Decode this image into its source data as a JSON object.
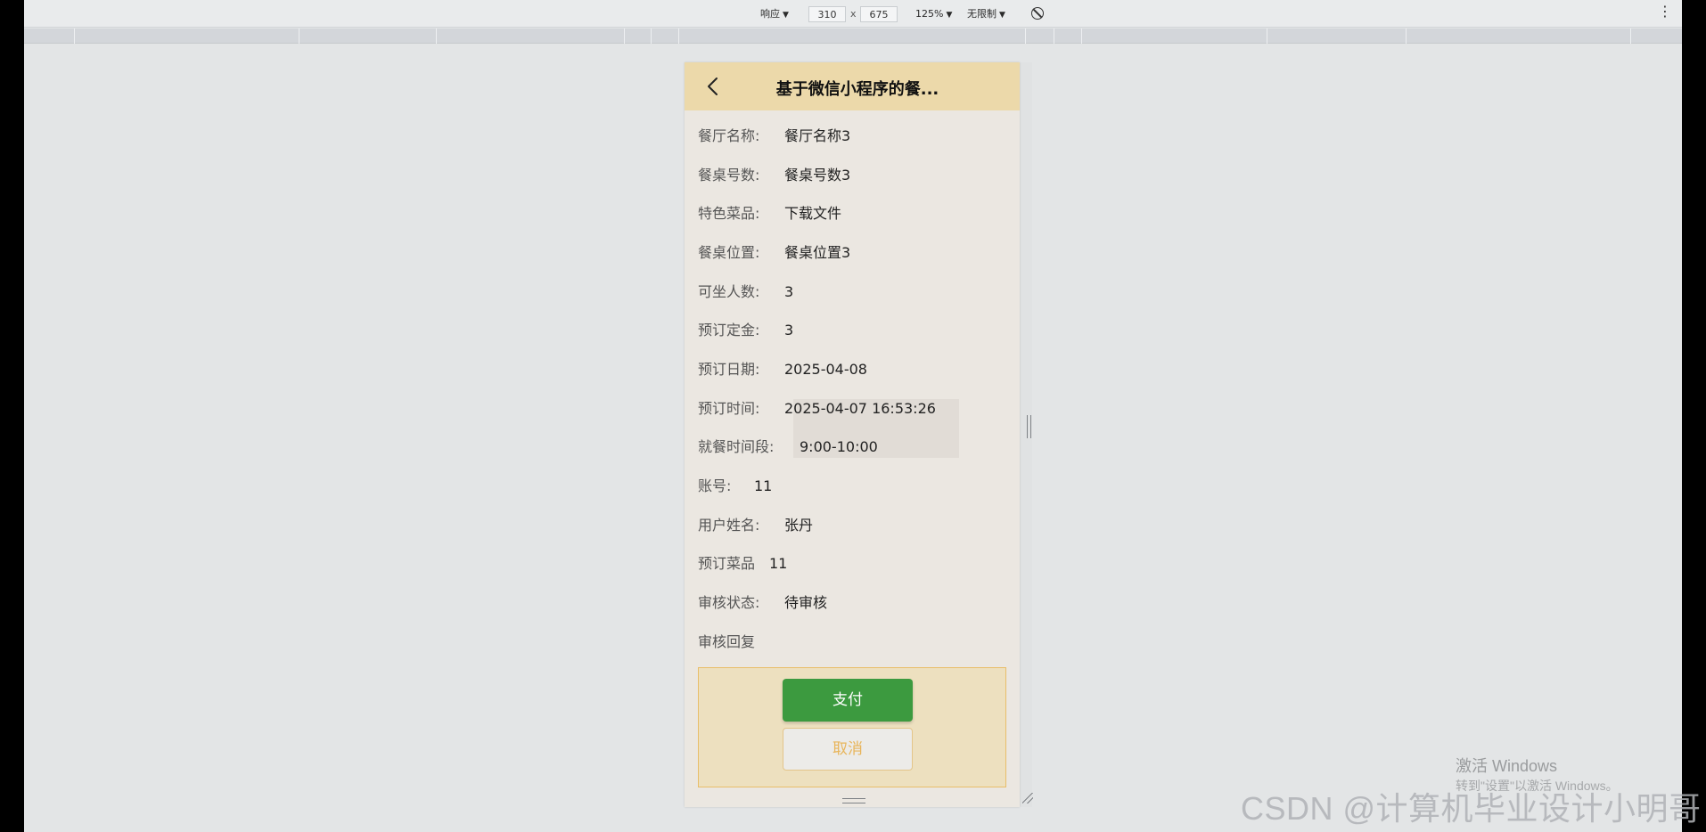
{
  "toolbar": {
    "device_mode": "响应",
    "width_value": "310",
    "height_value": "675",
    "dimension_separator": "x",
    "zoom": "125%",
    "throttle": "无限制",
    "more": "⋮"
  },
  "page": {
    "title": "基于微信小程序的餐...",
    "rows": [
      {
        "label": "餐厅名称:",
        "value": "餐厅名称3"
      },
      {
        "label": "餐桌号数:",
        "value": "餐桌号数3"
      },
      {
        "label": "特色菜品:",
        "value": "下载文件"
      },
      {
        "label": "餐桌位置:",
        "value": "餐桌位置3"
      },
      {
        "label": "可坐人数:",
        "value": "3"
      },
      {
        "label": "预订定金:",
        "value": "3"
      },
      {
        "label": "预订日期:",
        "value": "2025-04-08"
      },
      {
        "label": "预订时间:",
        "value": "2025-04-07 16:53:26"
      },
      {
        "label": "就餐时间段:",
        "value": "9:00-10:00"
      },
      {
        "label": "账号:",
        "value": "11"
      },
      {
        "label": "用户姓名:",
        "value": "张丹"
      },
      {
        "label": "预订菜品",
        "value": "11"
      },
      {
        "label": "审核状态:",
        "value": "待审核"
      },
      {
        "label": "审核回复",
        "value": ""
      }
    ],
    "pay_button": "支付",
    "cancel_button": "取消"
  },
  "watermarks": {
    "windows_title": "激活 Windows",
    "windows_subtitle": "转到\"设置\"以激活 Windows。",
    "csdn": "CSDN @计算机毕业设计小明哥"
  },
  "colors": {
    "nav_bg": "#ecd9aa",
    "page_bg": "#ebe7e1",
    "pay_green": "#3c9a3f",
    "cancel_text": "#e8b55a",
    "action_border": "#e8be6a"
  }
}
